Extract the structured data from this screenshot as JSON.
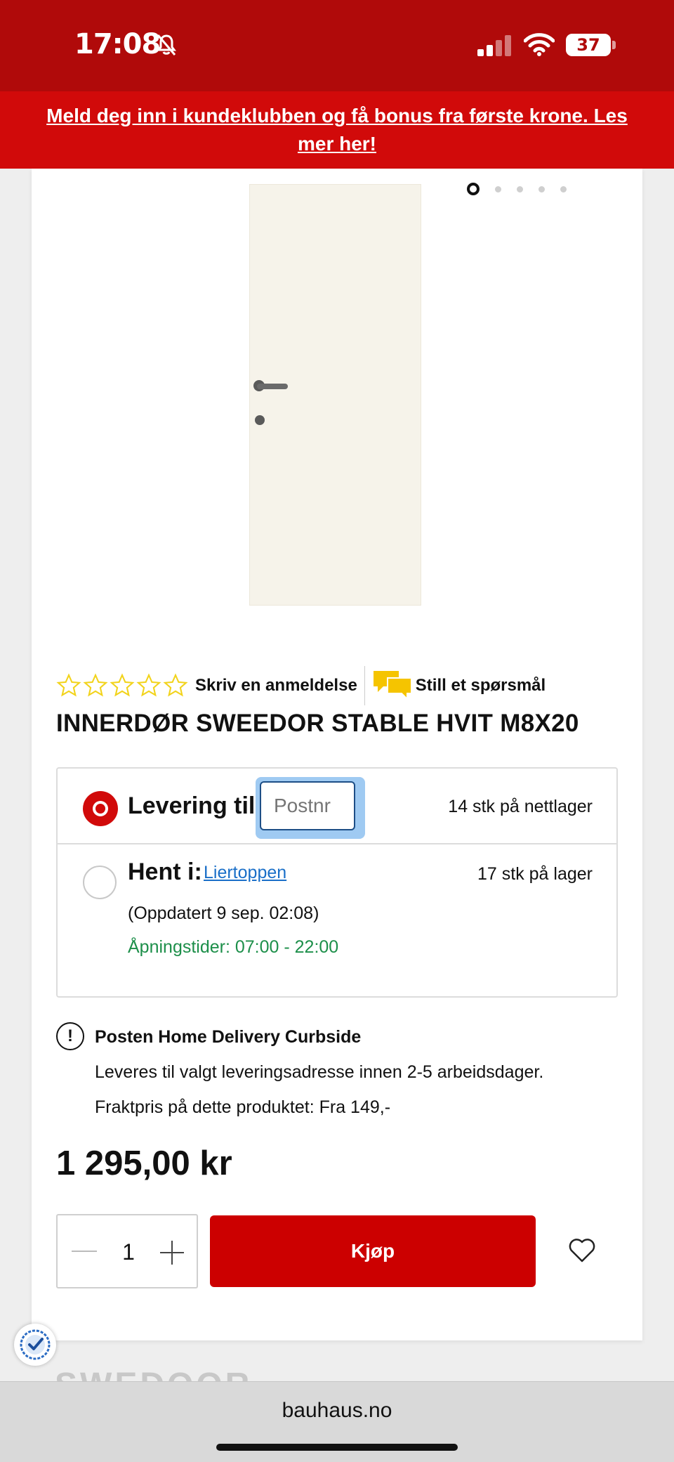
{
  "status_bar": {
    "time": "17:08",
    "battery_level": "37"
  },
  "promo_banner": {
    "text": "Meld deg inn i kundeklubben og få bonus fra første krone. Les mer her!"
  },
  "carousel": {
    "slide_count": 5,
    "active_index": 0
  },
  "rating": {
    "stars_filled": 0,
    "stars_total": 5,
    "write_review": "Skriv en anmeldelse",
    "ask_question": "Still et spørsmål"
  },
  "product": {
    "title": "INNERDØR SWEEDOR STABLE HVIT M8X20",
    "price": "1 295,00 kr"
  },
  "delivery": {
    "option_label": "Levering til:",
    "postnr_placeholder": "Postnr",
    "online_stock": "14 stk på nettlager",
    "pickup_label": "Hent i:",
    "store_name": "Liertoppen",
    "store_stock": "17 stk på lager",
    "updated": "(Oppdatert 9 sep. 02:08)",
    "opening_hours": "Åpningstider: 07:00 - 22:00"
  },
  "shipping": {
    "title": "Posten Home Delivery Curbside",
    "description": "Leveres til valgt leveringsadresse innen 2-5 arbeidsdager.",
    "freight_price": "Fraktpris på dette produktet: Fra 149,-"
  },
  "cart": {
    "quantity": "1",
    "buy_label": "Kjøp"
  },
  "browser": {
    "url": "bauhaus.no"
  },
  "colors": {
    "brand_red": "#cc0000",
    "status_red": "#b00a0a",
    "star_yellow": "#f2d31b",
    "link_blue": "#1a6fc8",
    "open_green": "#1d8f4a"
  }
}
